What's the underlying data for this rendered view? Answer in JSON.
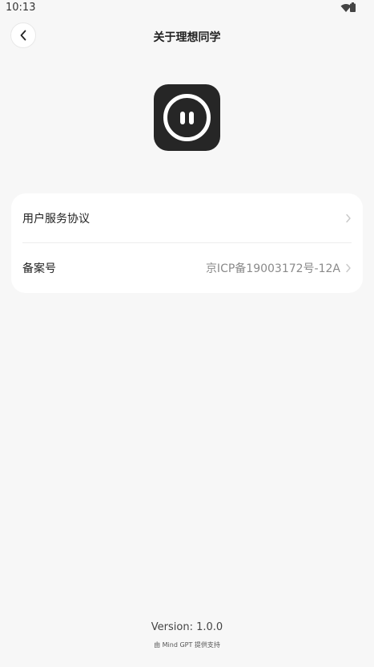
{
  "status_bar": {
    "time": "10:13",
    "icons": [
      "wifi-icon",
      "battery-icon"
    ]
  },
  "header": {
    "title": "关于理想同学",
    "back_icon": "chevron-left-icon"
  },
  "logo": {
    "icon": "app-logo-face-icon",
    "background_color": "#262626"
  },
  "card": {
    "rows": [
      {
        "label": "用户服务协议",
        "value": "",
        "icon": "chevron-right-icon"
      },
      {
        "label": "备案号",
        "value": "京ICP备19003172号-12A",
        "icon": "chevron-right-icon"
      }
    ]
  },
  "footer": {
    "version": "Version: 1.0.0",
    "provider": "由 Mind GPT 提供支持"
  },
  "colors": {
    "background": "#f7f7f7",
    "card": "#ffffff",
    "secondary_text": "#8a8a8a"
  }
}
